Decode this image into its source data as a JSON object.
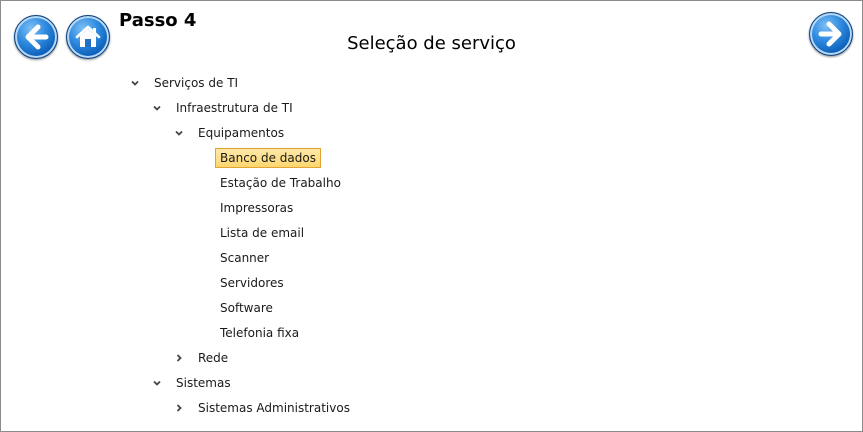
{
  "header": {
    "step": "Passo 4",
    "title": "Seleção de serviço",
    "back_icon": "arrow-left-icon",
    "home_icon": "home-icon",
    "next_icon": "arrow-right-icon"
  },
  "colors": {
    "button_blue": "#2f8be0",
    "selection_fill": "#fdd66e",
    "selection_border": "#e2a432"
  },
  "tree": {
    "nodes": [
      {
        "label": "Serviços de TI",
        "level": 0,
        "toggle": "expanded"
      },
      {
        "label": "Infraestrutura de TI",
        "level": 1,
        "toggle": "expanded"
      },
      {
        "label": "Equipamentos",
        "level": 2,
        "toggle": "expanded"
      },
      {
        "label": "Banco de dados",
        "level": 3,
        "toggle": "none",
        "selected": true
      },
      {
        "label": "Estação de Trabalho",
        "level": 3,
        "toggle": "none"
      },
      {
        "label": "Impressoras",
        "level": 3,
        "toggle": "none"
      },
      {
        "label": "Lista de email",
        "level": 3,
        "toggle": "none"
      },
      {
        "label": "Scanner",
        "level": 3,
        "toggle": "none"
      },
      {
        "label": "Servidores",
        "level": 3,
        "toggle": "none"
      },
      {
        "label": "Software",
        "level": 3,
        "toggle": "none"
      },
      {
        "label": "Telefonia fixa",
        "level": 3,
        "toggle": "none"
      },
      {
        "label": "Rede",
        "level": 2,
        "toggle": "collapsed"
      },
      {
        "label": "Sistemas",
        "level": 1,
        "toggle": "expanded"
      },
      {
        "label": "Sistemas Administrativos",
        "level": 2,
        "toggle": "collapsed"
      }
    ]
  }
}
